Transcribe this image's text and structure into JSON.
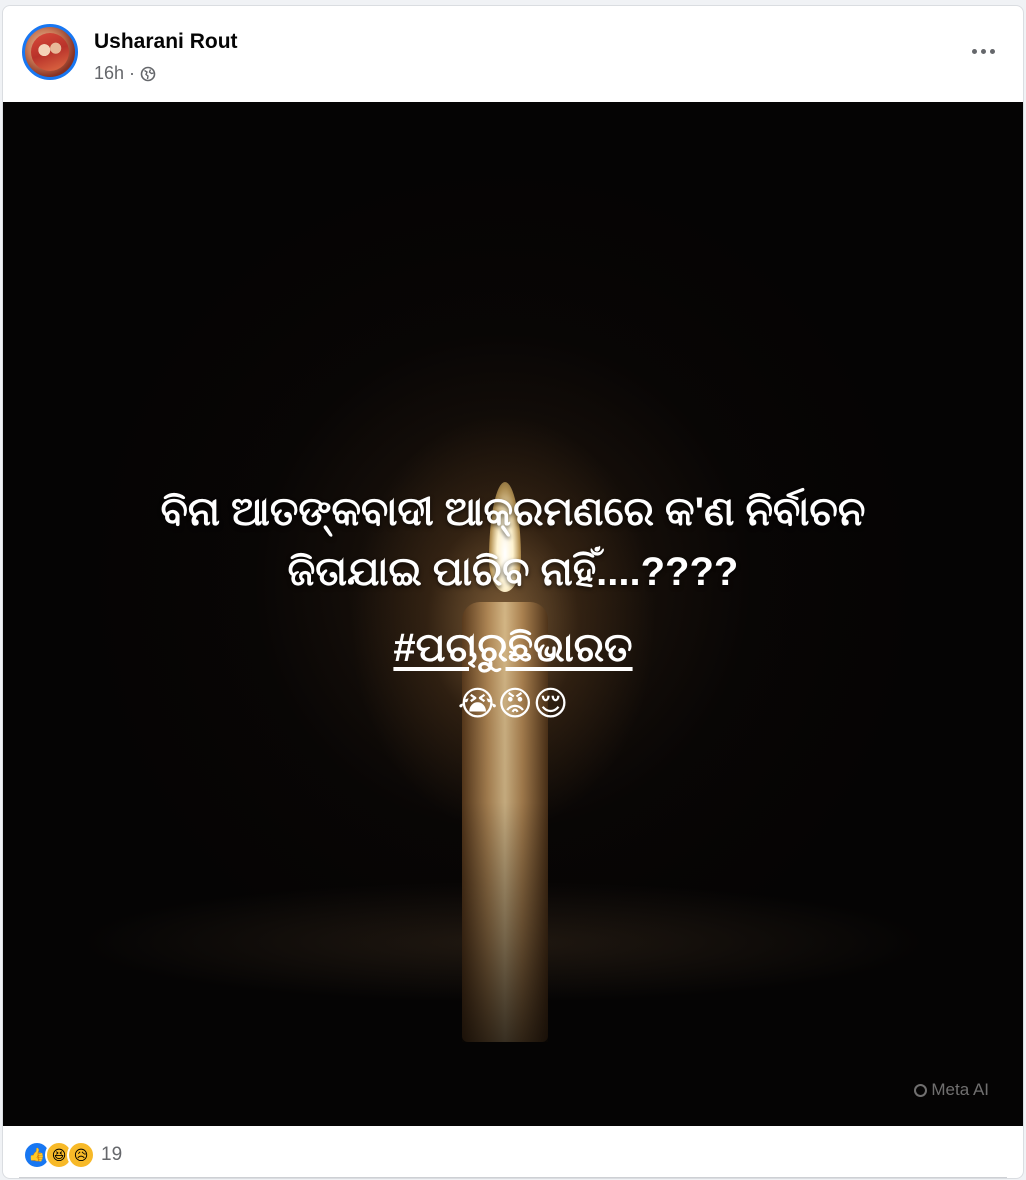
{
  "post": {
    "author": "Usharani Rout",
    "time": "16h",
    "separator": "·",
    "privacy_icon": "globe-icon",
    "more_icon": "more-options-icon"
  },
  "image": {
    "line1": "ବିନା ଆତଙ୍କବାଦୀ ଆକ୍ରମଣରେ କ'ଣ ନିର୍ବାଚନ",
    "line2": "ଜିତାଯାଇ ପାରିବ ନାହିଁ....????",
    "hashtag": "#ପଚାରୁଛିଭାରତ",
    "emojis": "😭😡😌",
    "watermark": "Meta AI"
  },
  "reactions": {
    "icons": [
      "like-icon",
      "haha-icon",
      "sad-icon"
    ],
    "like_glyph": "👍",
    "haha_glyph": "😆",
    "sad_glyph": "😥",
    "count": "19"
  },
  "colors": {
    "accent": "#1877f2",
    "secondary_text": "#65676b",
    "name_text": "#050505"
  }
}
